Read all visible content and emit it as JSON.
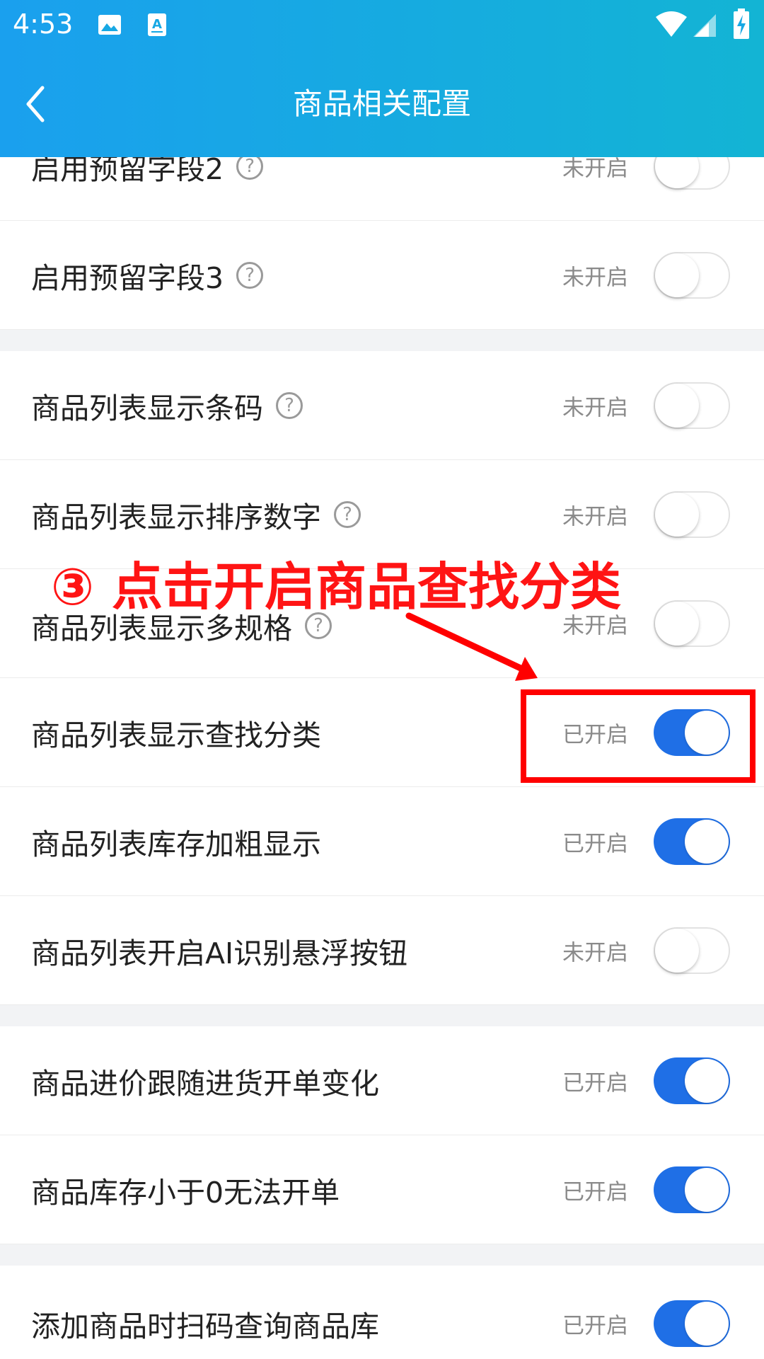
{
  "statusbar": {
    "time": "4:53",
    "icons": [
      "image-icon",
      "text-recognition-icon",
      "wifi-icon",
      "signal-icon",
      "battery-charging-icon"
    ]
  },
  "header": {
    "title": "商品相关配置",
    "back_icon": "chevron-left-icon",
    "gradient": [
      "#1aa0ee",
      "#13b4d4"
    ]
  },
  "settings": {
    "rows": [
      {
        "label": "启用预留字段2",
        "help": "?",
        "status": "未开启",
        "enabled": false
      },
      {
        "label": "启用预留字段3",
        "help": "?",
        "status": "未开启",
        "enabled": false
      },
      {
        "label": "商品列表显示条码",
        "help": "?",
        "status": "未开启",
        "enabled": false
      },
      {
        "label": "商品列表显示排序数字",
        "help": "?",
        "status": "未开启",
        "enabled": false
      },
      {
        "label": "商品列表显示多规格",
        "help": "?",
        "status": "未开启",
        "enabled": false
      },
      {
        "label": "商品列表显示查找分类",
        "status": "已开启",
        "enabled": true
      },
      {
        "label": "商品列表库存加粗显示",
        "status": "已开启",
        "enabled": true
      },
      {
        "label": "商品列表开启AI识别悬浮按钮",
        "status": "未开启",
        "enabled": false
      },
      {
        "label": "商品进价跟随进货开单变化",
        "status": "已开启",
        "enabled": true
      },
      {
        "label": "商品库存小于0无法开单",
        "status": "已开启",
        "enabled": true
      },
      {
        "label": "添加商品时扫码查询商品库",
        "status": "已开启",
        "enabled": true
      }
    ]
  },
  "annotation": {
    "text": "③ 点击开启商品查找分类",
    "color": "#ff0000"
  },
  "colors": {
    "toggle_on": "#1f6fe6",
    "toggle_off_border": "#e2e2e2",
    "separator": "#f2f3f5"
  }
}
